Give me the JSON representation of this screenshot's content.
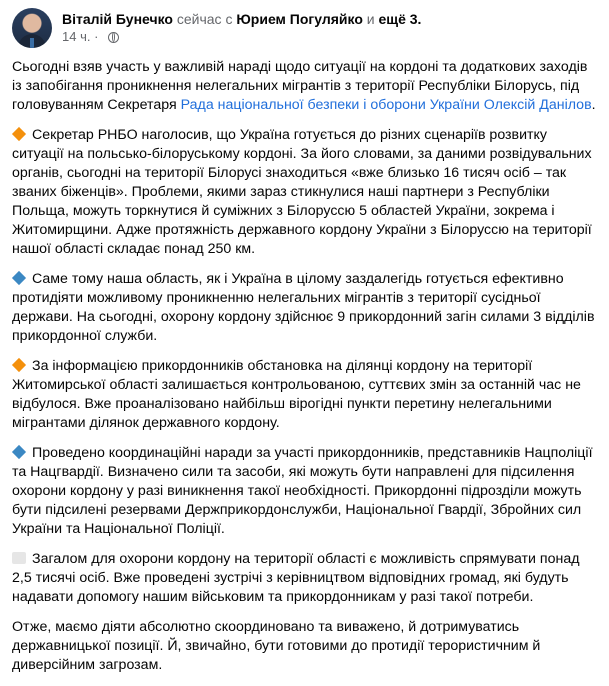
{
  "post": {
    "author": "Віталій Бунечко",
    "with_text": "сейчас с",
    "tagged": "Юрием Погуляйко",
    "and_text": "и",
    "more": "ещё 3.",
    "time": "14 ч.",
    "privacy_icon": "globe-icon"
  },
  "paragraphs": {
    "p1_a": "Сьогодні взяв участь у важливій нараді щодо ситуації на кордоні та додаткових заходів із запобігання проникнення нелегальних мігрантів з території Республіки Білорусь, під головуванням Секретаря ",
    "p1_link": "Рада національної безпеки і оборони України Олексій Данілов",
    "p1_b": ".",
    "p2": "Секретар РНБО наголосив, що Україна готується до різних сценаріїв розвитку ситуації на польсько-білоруському кордоні. За його словами, за даними розвідувальних органів, сьогодні на території Білорусі знаходиться «вже близько 16 тисяч осіб – так званих біженців». Проблеми, якими зараз стикнулися наші партнери з Республіки Польща, можуть торкнутися й суміжних з Білоруссю 5 областей України, зокрема і Житомирщини. Адже протяжність державного кордону України з Білоруссю на території нашої області складає понад 250 км.",
    "p3": "Саме тому наша область, як і Україна в цілому заздалегідь готується ефективно протидіяти можливому проникненню нелегальних мігрантів з території сусідньої держави. На сьогодні, охорону кордону здійснює 9 прикордонний загін силами 3 відділів прикордонної служби.",
    "p4": "За інформацією прикордонників обстановка на ділянці кордону на території Житомирської області залишається контрольованою, суттєвих змін за останній час не відбулося. Вже проаналізовано найбільш вірогідні пункти перетину нелегальними мігрантами ділянок державного кордону.",
    "p5": "Проведено координаційні наради за участі прикордонників, представників Нацполіції та Нацгвардії. Визначено сили та засоби, які можуть бути направлені для підсилення охорони кордону у разі виникнення такої необхідності. Прикордонні підрозділи можуть бути підсилені резервами Держприкордонслужби, Національної Гвардії, Збройних сил України та Національної Поліції.",
    "p6": "Загалом для охорони кордону на території області є можливість спрямувати понад 2,5 тисячі осіб. Вже проведені зустрічі з керівництвом відповідних громад, які будуть надавати допомогу нашим військовим та прикордонникам у разі такої потреби.",
    "p7": "Отже, маємо діяти абсолютно скоординовано та виважено, й дотримуватись державницької позиції. Й, звичайно, бути готовими до протидії терористичним й диверсійним загрозам."
  },
  "emoji_icons": {
    "p2": "orange-diamond-icon",
    "p3": "blue-diamond-icon",
    "p4": "orange-diamond-icon",
    "p5": "blue-diamond-icon",
    "p6": "page-icon"
  },
  "colors": {
    "link": "#216fdb",
    "muted": "#65676b",
    "text": "#050505",
    "orange_diamond": "#f4900c",
    "blue_diamond": "#3b88c3"
  }
}
